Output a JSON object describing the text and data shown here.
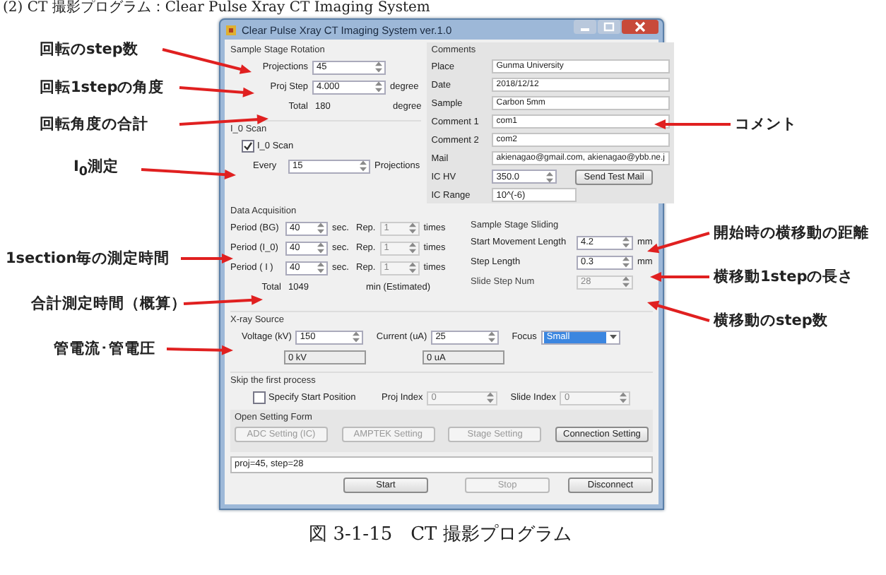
{
  "heading": "(2) CT 撮影プログラム：Clear Pulse Xray CT Imaging System",
  "window": {
    "title": "Clear Pulse Xray CT Imaging System ver.1.0"
  },
  "rotation": {
    "title": "Sample Stage Rotation",
    "fields": [
      {
        "label": "Projections",
        "value": "45"
      },
      {
        "label": "Proj Step",
        "value": "4.000",
        "unit": "degree"
      }
    ],
    "total": {
      "label": "Total",
      "value": "180",
      "unit": "degree"
    }
  },
  "i0_scan": {
    "title": "I_0 Scan",
    "checkbox": {
      "label": "I_0 Scan",
      "checked": true
    },
    "field": {
      "label": "Every",
      "value": "15",
      "unit": "Projections"
    }
  },
  "comments": {
    "title": "Comments",
    "fields": [
      {
        "label": "Place",
        "value": "Gunma University",
        "kind": "text"
      },
      {
        "label": "Date",
        "value": "2018/12/12",
        "kind": "text"
      },
      {
        "label": "Sample",
        "value": "Carbon 5mm",
        "kind": "text"
      },
      {
        "label": "Comment 1",
        "value": "com1",
        "kind": "text"
      },
      {
        "label": "Comment 2",
        "value": "com2",
        "kind": "text"
      },
      {
        "label": "Mail",
        "value": "akienagao@gmail.com, akienagao@ybb.ne.j",
        "kind": "text"
      },
      {
        "label": "IC HV",
        "value": "350.0",
        "kind": "spin"
      },
      {
        "label": "IC Range",
        "value": "10^(-6)",
        "kind": "short"
      }
    ],
    "button": "Send Test Mail"
  },
  "acquisition": {
    "title": "Data Acquisition",
    "rows": [
      {
        "label": "Period (BG)",
        "value": "40",
        "unit": "sec.",
        "rep": {
          "label": "Rep.",
          "value": "1",
          "unit": "times",
          "disabled": true
        }
      },
      {
        "label": "Period (I_0)",
        "value": "40",
        "unit": "sec.",
        "rep": {
          "label": "Rep.",
          "value": "1",
          "unit": "times",
          "disabled": true
        }
      },
      {
        "label": "Period ( I )",
        "value": "40",
        "unit": "sec.",
        "rep": {
          "label": "Rep.",
          "value": "1",
          "unit": "times",
          "disabled": true
        }
      }
    ],
    "total": {
      "label": "Total",
      "value": "1049",
      "unit": "min (Estimated)"
    }
  },
  "sliding": {
    "title": "Sample Stage Sliding",
    "fields": [
      {
        "label": "Start Movement Length",
        "value": "4.2",
        "unit": "mm",
        "disabled": false
      },
      {
        "label": "Step Length",
        "value": "0.3",
        "unit": "mm",
        "disabled": false
      },
      {
        "label": "Slide Step Num",
        "value": "28",
        "disabled": true
      }
    ]
  },
  "xray": {
    "title": "X-ray Source",
    "voltage": {
      "label": "Voltage (kV)",
      "value": "150",
      "reading": "0 kV"
    },
    "current": {
      "label": "Current (uA)",
      "value": "25",
      "reading": "0 uA"
    },
    "focus": {
      "label": "Focus",
      "value": "Small"
    }
  },
  "skip": {
    "title": "Skip the first process",
    "checkbox": {
      "label": "Specify Start Position",
      "checked": false
    },
    "fields": [
      {
        "label": "Proj Index",
        "value": "0",
        "disabled": true
      },
      {
        "label": "Slide Index",
        "value": "0",
        "disabled": true
      }
    ]
  },
  "settings": {
    "title": "Open Setting Form",
    "buttons": [
      {
        "label": "ADC Setting (IC)",
        "disabled": true
      },
      {
        "label": "AMPTEK Setting",
        "disabled": true
      },
      {
        "label": "Stage Setting",
        "disabled": true
      },
      {
        "label": "Connection Setting",
        "disabled": false
      }
    ]
  },
  "status": "proj=45, step=28",
  "actions": [
    {
      "label": "Start",
      "disabled": false
    },
    {
      "label": "Stop",
      "disabled": true
    },
    {
      "label": "Disconnect",
      "disabled": false
    }
  ],
  "annotations_left": [
    "回転のstep数",
    "回転1stepの角度",
    "回転角度の合計",
    "I$_{0}$測定",
    "1section毎の測定時間",
    "合計測定時間（概算）",
    "管電流･管電圧"
  ],
  "annotations_right": [
    "コメント",
    "開始時の横移動の距離",
    "横移動1stepの長さ",
    "横移動のstep数"
  ],
  "caption": "図 3-1-15　CT 撮影プログラム"
}
